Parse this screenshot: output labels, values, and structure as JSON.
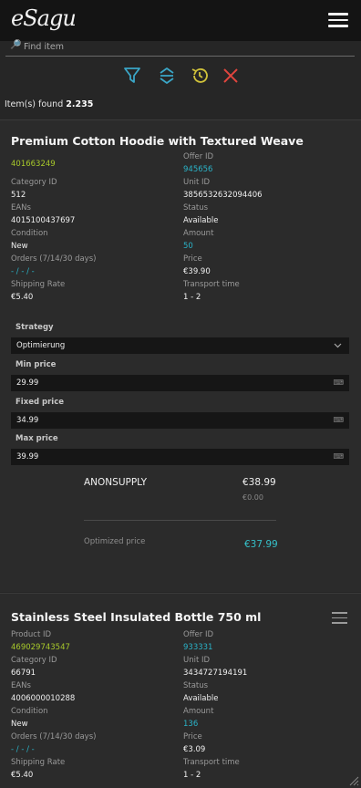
{
  "app": {
    "logo_text": "eSagu",
    "logo_sub": "..."
  },
  "search": {
    "placeholder": "Find item"
  },
  "toolbar": {
    "colors": {
      "filter": "#3aa6c7",
      "sort": "#3aa6c7",
      "history": "#d0c23a",
      "clear": "#e0453e"
    }
  },
  "results": {
    "label": "Item(s) found",
    "count": "2.235"
  },
  "item1": {
    "title": "Premium Cotton Hoodie with Textured Weave",
    "product_id": "401663249",
    "offer_id_label": "Offer ID",
    "offer_id": "945656",
    "category_id_label": "Category ID",
    "category_id": "512",
    "unit_id_label": "Unit ID",
    "unit_id": "3856532632094406",
    "eans_label": "EANs",
    "eans": "4015100437697",
    "status_label": "Status",
    "status": "Available",
    "condition_label": "Condition",
    "condition": "New",
    "amount_label": "Amount",
    "amount": "50",
    "orders_label": "Orders (7/14/30 days)",
    "orders": "- / - / -",
    "price_label": "Price",
    "price": "€39.90",
    "shipping_label": "Shipping Rate",
    "shipping": "€5.40",
    "transport_label": "Transport time",
    "transport": "1 - 2",
    "strategy_label": "Strategy",
    "strategy": "Optimierung",
    "min_price_label": "Min price",
    "min_price": "29.99",
    "fixed_price_label": "Fixed price",
    "fixed_price": "34.99",
    "max_price_label": "Max price",
    "max_price": "39.99",
    "competitor": {
      "name": "ANONSUPPLY",
      "price": "€38.99",
      "shipping": "€0.00"
    },
    "optimized_label": "Optimized price",
    "optimized_price": "€37.99"
  },
  "item2": {
    "title": "Stainless Steel Insulated Bottle 750 ml",
    "product_id_label": "Product ID",
    "product_id": "469029743547",
    "offer_id_label": "Offer ID",
    "offer_id": "933331",
    "category_id_label": "Category ID",
    "category_id": "66791",
    "unit_id_label": "Unit ID",
    "unit_id": "3434727194191",
    "eans_label": "EANs",
    "eans": "4006000010288",
    "status_label": "Status",
    "status": "Available",
    "condition_label": "Condition",
    "condition": "New",
    "amount_label": "Amount",
    "amount": "136",
    "orders_label": "Orders (7/14/30 days)",
    "orders": "- / - / -",
    "price_label": "Price",
    "price": "€3.09",
    "shipping_label": "Shipping Rate",
    "shipping": "€5.40",
    "transport_label": "Transport time",
    "transport": "1 - 2"
  }
}
